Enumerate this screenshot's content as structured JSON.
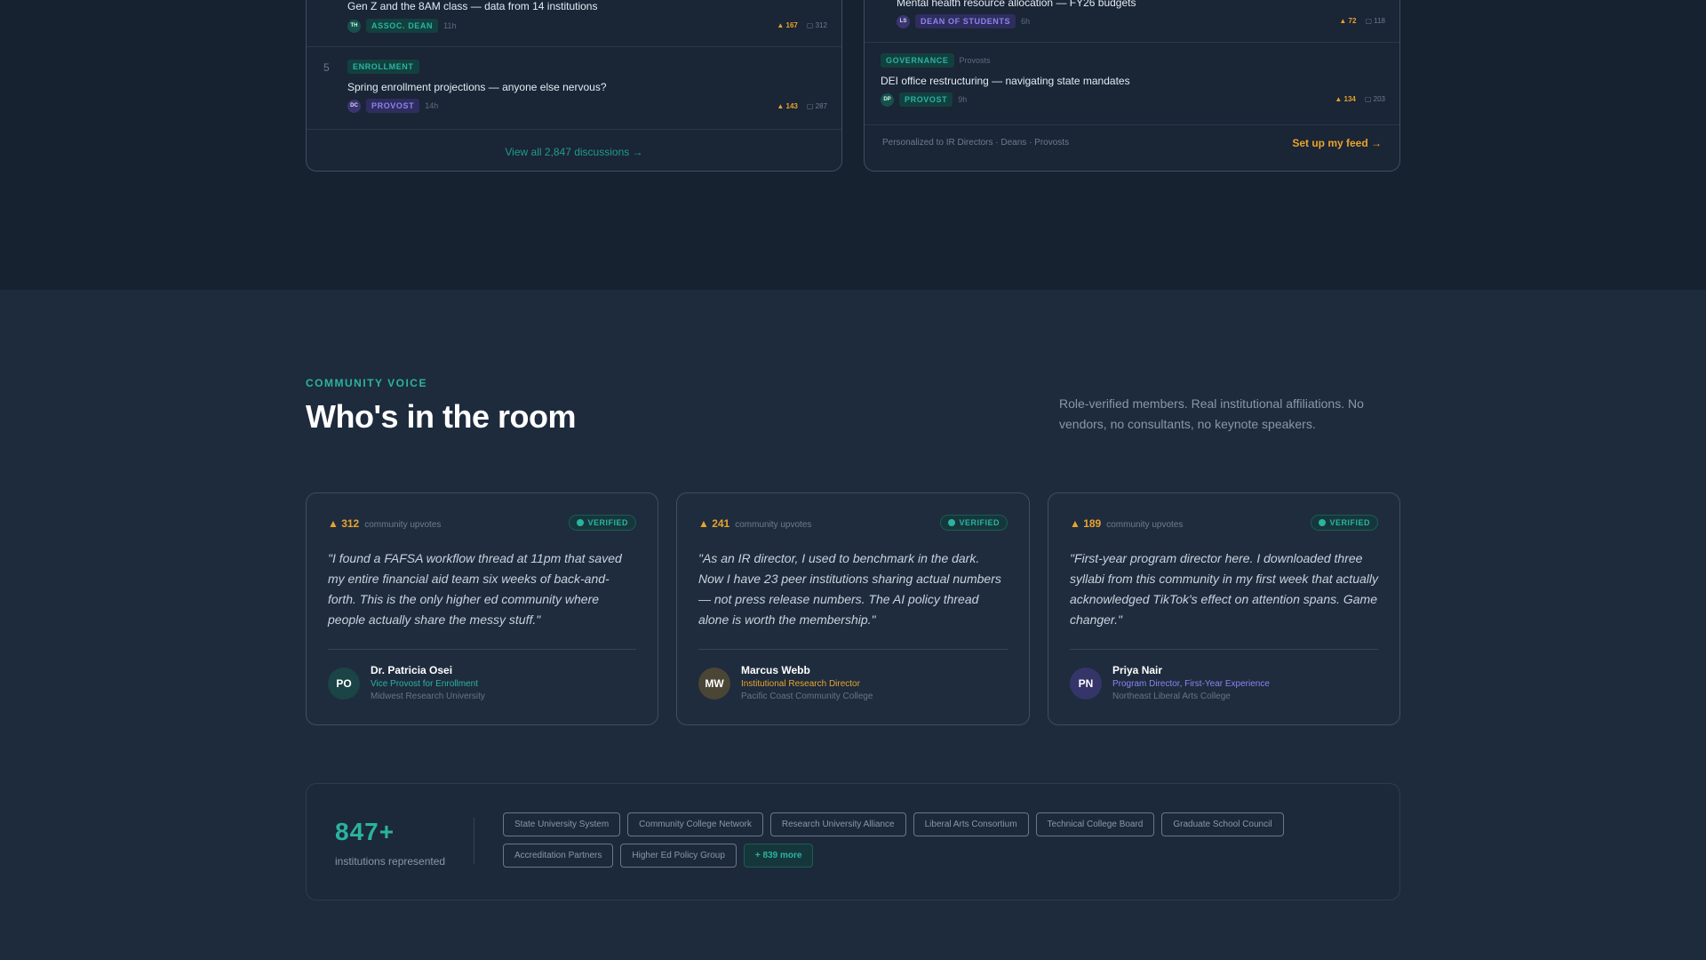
{
  "discussions_panel": {
    "rows": [
      {
        "title": "Gen Z and the 8AM class — data from 14 institutions",
        "avatar": "TH",
        "role": "ASSOC. DEAN",
        "time": "11h",
        "upvotes": "▲ 167",
        "comments": "▢ 312"
      },
      {
        "number": "5",
        "tag": "ENROLLMENT",
        "title": "Spring enrollment projections — anyone else nervous?",
        "avatar": "DC",
        "role": "PROVOST",
        "time": "14h",
        "upvotes": "▲ 143",
        "comments": "▢ 287"
      }
    ],
    "view_all": "View all 2,847 discussions →"
  },
  "feed_panel": {
    "rows": [
      {
        "title": "Mental health resource allocation — FY26 budgets",
        "avatar": "LS",
        "role": "DEAN OF STUDENTS",
        "time": "6h",
        "upvotes": "▲ 72",
        "comments": "▢ 118"
      },
      {
        "tag": "GOVERNANCE",
        "tag_audience": "Provosts",
        "title": "DEI office restructuring — navigating state mandates",
        "avatar": "DP",
        "role": "PROVOST",
        "time": "9h",
        "upvotes": "▲ 134",
        "comments": "▢ 203"
      }
    ],
    "personalized_text": "Personalized to IR Directors · Deans · Provosts",
    "setup_label": "Set up my feed →"
  },
  "community": {
    "eyebrow": "COMMUNITY VOICE",
    "heading": "Who's in the room",
    "lede": "Role-verified members. Real institutional affiliations. No vendors, no consultants, no keynote speakers."
  },
  "testimonials": [
    {
      "upvotes": "▲ 312",
      "upvotes_label": "community upvotes",
      "verified": "VERIFIED",
      "quote": "\"I found a FAFSA workflow thread at 11pm that saved my entire financial aid team six weeks of back-and-forth. This is the only higher ed community where people actually share the messy stuff.\"",
      "initials": "PO",
      "name": "Dr. Patricia Osei",
      "role": "Vice Provost for Enrollment",
      "org": "Midwest Research University",
      "role_color": "#2bb3a0",
      "avatar_bg": "#1a4446"
    },
    {
      "upvotes": "▲ 241",
      "upvotes_label": "community upvotes",
      "verified": "VERIFIED",
      "quote": "\"As an IR director, I used to benchmark in the dark. Now I have 23 peer institutions sharing actual numbers — not press release numbers. The AI policy thread alone is worth the membership.\"",
      "initials": "MW",
      "name": "Marcus Webb",
      "role": "Institutional Research Director",
      "org": "Pacific Coast Community College",
      "role_color": "#eaa32b",
      "avatar_bg": "#4a4535"
    },
    {
      "upvotes": "▲ 189",
      "upvotes_label": "community upvotes",
      "verified": "VERIFIED",
      "quote": "\"First-year program director here. I downloaded three syllabi from this community in my first week that actually acknowledged TikTok's effect on attention spans. Game changer.\"",
      "initials": "PN",
      "name": "Priya Nair",
      "role": "Program Director, First-Year Experience",
      "org": "Northeast Liberal Arts College",
      "role_color": "#8b84ef",
      "avatar_bg": "#35356a"
    }
  ],
  "institutions": {
    "count": "847+",
    "caption": "institutions represented",
    "chips": [
      "State University System",
      "Community College Network",
      "Research University Alliance",
      "Liberal Arts Consortium",
      "Technical College Board",
      "Graduate School Council",
      "Accreditation Partners",
      "Higher Ed Policy Group"
    ],
    "more": "+ 839 more"
  }
}
